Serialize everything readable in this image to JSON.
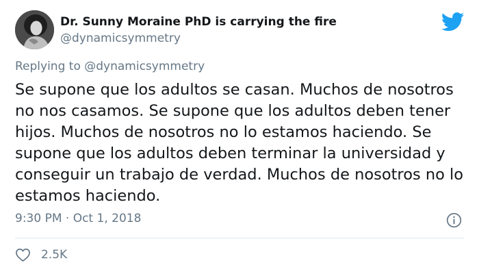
{
  "author": {
    "name": "Dr. Sunny Moraine PhD is carrying the fire",
    "handle": "@dynamicsymmetry"
  },
  "reply": {
    "label": "Replying to @dynamicsymmetry"
  },
  "tweet": {
    "text": "Se supone que los adultos se casan. Muchos de nosotros no nos casamos. Se supone que los adultos deben tener hijos. Muchos de nosotros no lo estamos haciendo. Se supone que los adultos deben terminar la universidad y conseguir un trabajo de verdad. Muchos de nosotros no lo estamos haciendo.",
    "meta": "9:30 PM · Oct 1, 2018"
  },
  "actions": {
    "likes": "2.5K"
  },
  "icons": {
    "brand": "twitter-bird-icon",
    "info": "info-icon",
    "like": "heart-icon"
  },
  "colors": {
    "brand": "#1da1f2",
    "muted": "#657786",
    "text": "#14171a",
    "divider": "#e1e8ed"
  }
}
